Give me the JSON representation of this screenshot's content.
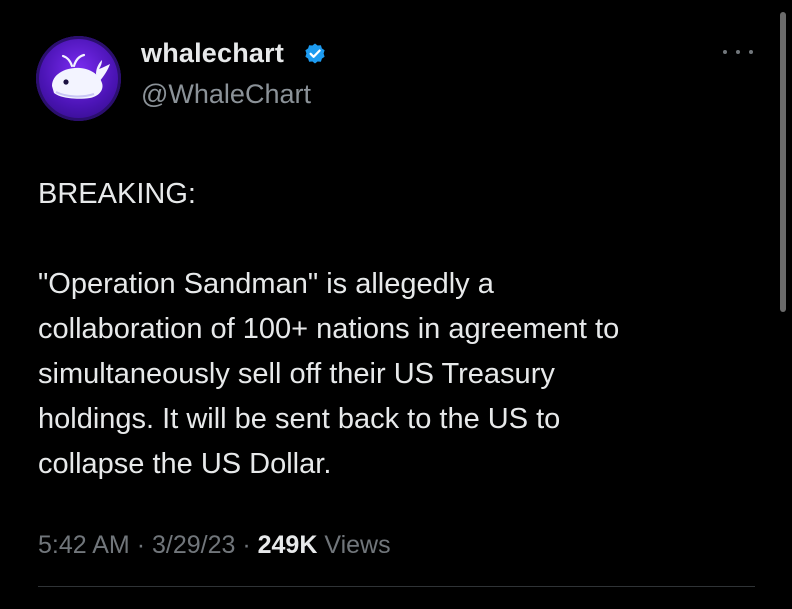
{
  "tweet": {
    "author": {
      "display_name": "whalechart",
      "handle": "@WhaleChart",
      "verified": true,
      "avatar_icon": "whale-icon",
      "avatar_color": "#6b23e6"
    },
    "body": {
      "heading": "BREAKING:",
      "paragraph_lines": [
        "\"Operation Sandman\" is allegedly a",
        "collaboration of 100+ nations in agreement to",
        "simultaneously sell off their US Treasury",
        "holdings. It will be sent back to the US to",
        "collapse the US Dollar."
      ]
    },
    "meta": {
      "time": "5:42 AM",
      "date": "3/29/23",
      "separator": "·",
      "views_count": "249K",
      "views_label": "Views"
    },
    "more_icon": "more-options-icon"
  },
  "colors": {
    "background": "#000000",
    "primary_text": "#e7e9ea",
    "secondary_text": "#71767b",
    "verified_badge": "#1d9bf0"
  }
}
